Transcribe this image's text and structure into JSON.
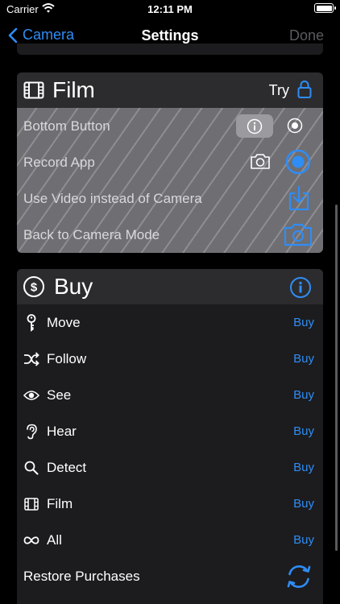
{
  "status": {
    "carrier": "Carrier",
    "time": "12:11 PM"
  },
  "nav": {
    "back_label": "Camera",
    "title": "Settings",
    "done_label": "Done"
  },
  "film": {
    "title": "Film",
    "try_label": "Try",
    "rows": [
      {
        "label": "Bottom Button"
      },
      {
        "label": "Record App"
      },
      {
        "label": "Use Video instead of Camera"
      },
      {
        "label": "Back to Camera Mode"
      }
    ]
  },
  "buy": {
    "title": "Buy",
    "items": [
      {
        "label": "Move",
        "action": "Buy",
        "icon": "key-icon"
      },
      {
        "label": "Follow",
        "action": "Buy",
        "icon": "shuffle-icon"
      },
      {
        "label": "See",
        "action": "Buy",
        "icon": "eye-icon"
      },
      {
        "label": "Hear",
        "action": "Buy",
        "icon": "ear-icon"
      },
      {
        "label": "Detect",
        "action": "Buy",
        "icon": "magnifier-icon"
      },
      {
        "label": "Film",
        "action": "Buy",
        "icon": "film-icon"
      },
      {
        "label": "All",
        "action": "Buy",
        "icon": "infinity-icon"
      }
    ],
    "restore_label": "Restore Purchases"
  },
  "colors": {
    "accent": "#2f8df6",
    "card": "#1c1c1e",
    "header": "#2c2c2e",
    "locked": "#6e6e73"
  }
}
